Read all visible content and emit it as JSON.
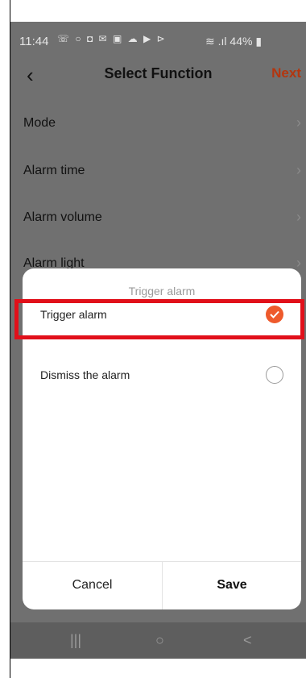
{
  "status_bar": {
    "time": "11:44",
    "notification_icons": [
      "phone-call-icon",
      "circle-icon",
      "record-icon",
      "mail-icon",
      "image-icon",
      "cloud-icon",
      "youtube-icon",
      "play-store-icon"
    ],
    "battery": "44%"
  },
  "header": {
    "title": "Select Function",
    "next_label": "Next"
  },
  "menu": {
    "items": [
      {
        "label": "Mode"
      },
      {
        "label": "Alarm time"
      },
      {
        "label": "Alarm volume"
      },
      {
        "label": "Alarm light"
      }
    ]
  },
  "dialog": {
    "title": "Trigger alarm",
    "options": [
      {
        "label": "Trigger alarm",
        "selected": true
      },
      {
        "label": "Dismiss the alarm",
        "selected": false
      }
    ],
    "cancel_label": "Cancel",
    "save_label": "Save"
  },
  "nav_bar": {
    "recents": "|||",
    "home": "○",
    "back": "<"
  },
  "colors": {
    "accent": "#ee5a2c",
    "next": "#b3360f",
    "highlight": "#e1101a",
    "overlay_bg": "#707070"
  }
}
